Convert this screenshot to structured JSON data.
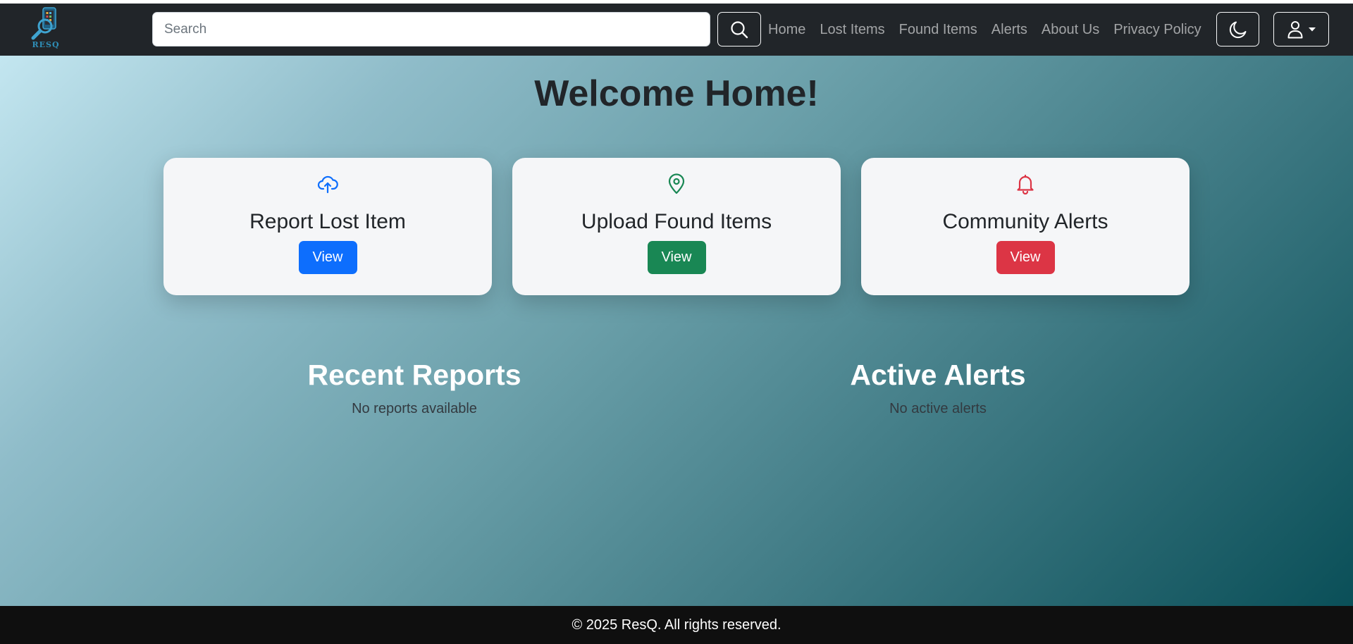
{
  "brand": {
    "logo_text": "RESQ"
  },
  "search": {
    "placeholder": "Search"
  },
  "nav": {
    "links": [
      "Home",
      "Lost Items",
      "Found Items",
      "Alerts",
      "About Us",
      "Privacy Policy"
    ]
  },
  "icons": {
    "search": "search-icon",
    "theme": "moon-icon",
    "user": "person-icon",
    "dropdown": "caret-down-icon",
    "report": "cloud-upload-icon",
    "upload": "map-pin-icon",
    "alerts": "bell-icon"
  },
  "main": {
    "title": "Welcome Home!"
  },
  "cards": [
    {
      "title": "Report Lost Item",
      "button": "View",
      "color": "#0d6efd"
    },
    {
      "title": "Upload Found Items",
      "button": "View",
      "color": "#198754"
    },
    {
      "title": "Community Alerts",
      "button": "View",
      "color": "#dc3545"
    }
  ],
  "sections": {
    "recent": {
      "title": "Recent Reports",
      "empty": "No reports available"
    },
    "alerts": {
      "title": "Active Alerts",
      "empty": "No active alerts"
    }
  },
  "footer": {
    "text": "© 2025 ResQ. All rights reserved."
  }
}
